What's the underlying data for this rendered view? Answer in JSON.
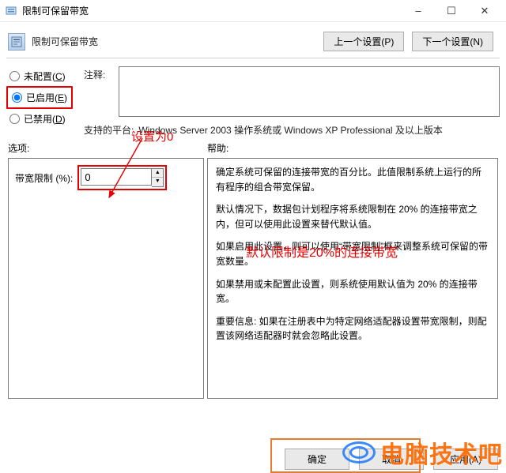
{
  "window": {
    "title": "限制可保留带宽"
  },
  "header": {
    "title": "限制可保留带宽",
    "prev_btn": "上一个设置(P)",
    "next_btn": "下一个设置(N)"
  },
  "radios": {
    "not_configured": "未配置(C)",
    "enabled": "已启用(E)",
    "disabled": "已禁用(D)",
    "selected": "enabled"
  },
  "labels": {
    "comment": "注释:",
    "supported": "支持的平台:",
    "options": "选项:",
    "help": "帮助:",
    "bandwidth_limit": "带宽限制 (%):"
  },
  "supported_value": "Windows Server 2003 操作系统或 Windows XP Professional 及以上版本",
  "comment_value": "",
  "option": {
    "bandwidth_value": "0"
  },
  "help_text": {
    "p1": "确定系统可保留的连接带宽的百分比。此值限制系统上运行的所有程序的组合带宽保留。",
    "p2": "默认情况下，数据包计划程序将系统限制在 20% 的连接带宽之内，但可以使用此设置来替代默认值。",
    "p3": "如果启用此设置，则可以使用“带宽限制”框来调整系统可保留的带宽数量。",
    "p4": "如果禁用或未配置此设置，则系统使用默认值为 20% 的连接带宽。",
    "p5": "重要信息: 如果在注册表中为特定网络适配器设置带宽限制，则配置该网络适配器时就会忽略此设置。"
  },
  "annotations": {
    "set_to": "设置为0",
    "default_limit": "默认限制是20%的连接带宽"
  },
  "footer": {
    "ok": "确定",
    "cancel": "取消",
    "apply": "应用(A)"
  },
  "watermark": "电脑技术吧"
}
